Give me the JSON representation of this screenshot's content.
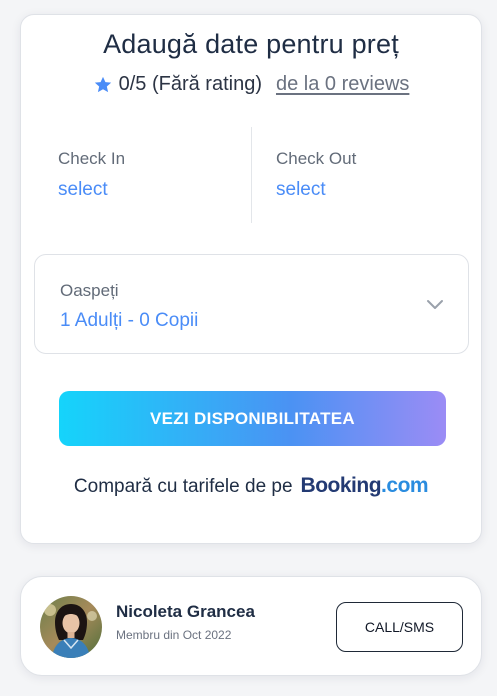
{
  "price_card": {
    "title": "Adaugă date pentru preț",
    "rating_text": "0/5 (Fără rating)",
    "reviews_link": "de la 0 reviews",
    "check_in": {
      "label": "Check In",
      "value": "select"
    },
    "check_out": {
      "label": "Check Out",
      "value": "select"
    },
    "guests": {
      "label": "Oaspeți",
      "value": "1 Adulți - 0 Copii"
    },
    "availability_button": "VEZI DISPONIBILITATEA",
    "compare_text": "Compară cu tarifele de pe",
    "booking_logo": {
      "main": "Booking",
      "dot": ".",
      "tld": "com"
    }
  },
  "host_card": {
    "name": "Nicoleta Grancea",
    "member_since": "Membru din Oct 2022",
    "call_button": "CALL/SMS"
  },
  "colors": {
    "accent_blue": "#4a8cf7",
    "star_blue": "#4a8cf7",
    "cta_gradient_start": "#15d4fb",
    "cta_gradient_end": "#9b8cf5",
    "booking_navy": "#233a73",
    "booking_blue": "#2a8cdf"
  },
  "icons": {
    "rating": "star-icon",
    "guests_dropdown": "chevron-down-icon"
  }
}
